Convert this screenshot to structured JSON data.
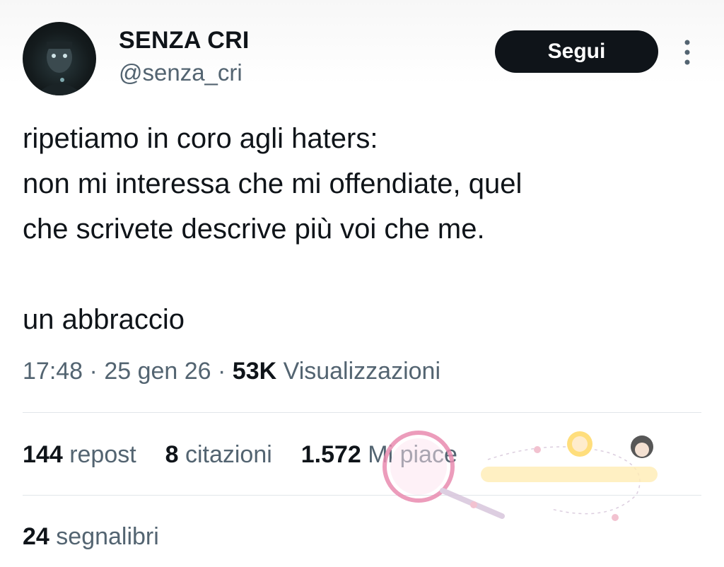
{
  "user": {
    "display_name": "SENZA CRI",
    "handle": "@senza_cri"
  },
  "follow_button": {
    "label": "Segui"
  },
  "more_icon": "vertical-dots-icon",
  "tweet": {
    "text": "ripetiamo in coro agli haters:\nnon mi interessa che mi offendiate, quel\nche scrivete descrive più voi che me.\n\nun abbraccio"
  },
  "meta": {
    "time": "17:48",
    "sep1": " · ",
    "date": "25 gen 26",
    "sep2": " · ",
    "views_count": "53K",
    "views_label": "Visualizzazioni"
  },
  "stats": {
    "reposts_count": "144",
    "reposts_label": "repost",
    "quotes_count": "8",
    "quotes_label": "citazioni",
    "likes_count": "1.572",
    "likes_label": "Mi piace",
    "bookmarks_count": "24",
    "bookmarks_label": "segnalibri"
  },
  "colors": {
    "text_primary": "#0f1419",
    "text_secondary": "#536471",
    "button_bg": "#0f1419",
    "divider": "#e1e6ea",
    "watermark_pink": "#e98bb0"
  }
}
